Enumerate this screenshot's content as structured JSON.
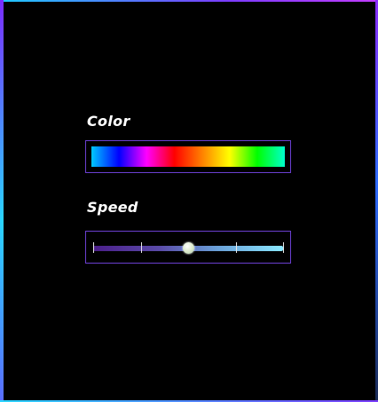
{
  "color_section": {
    "label": "Color",
    "gradient_stops": [
      "#00c8ff",
      "#0000ff",
      "#ff00ff",
      "#ff0000",
      "#ff8000",
      "#ffff00",
      "#00ff00",
      "#00ffcc"
    ]
  },
  "speed_section": {
    "label": "Speed",
    "value": 0.5,
    "tick_count": 5
  },
  "colors": {
    "background": "#000000",
    "box_border": "#6a3fd0",
    "label_text": "#ffffff"
  }
}
